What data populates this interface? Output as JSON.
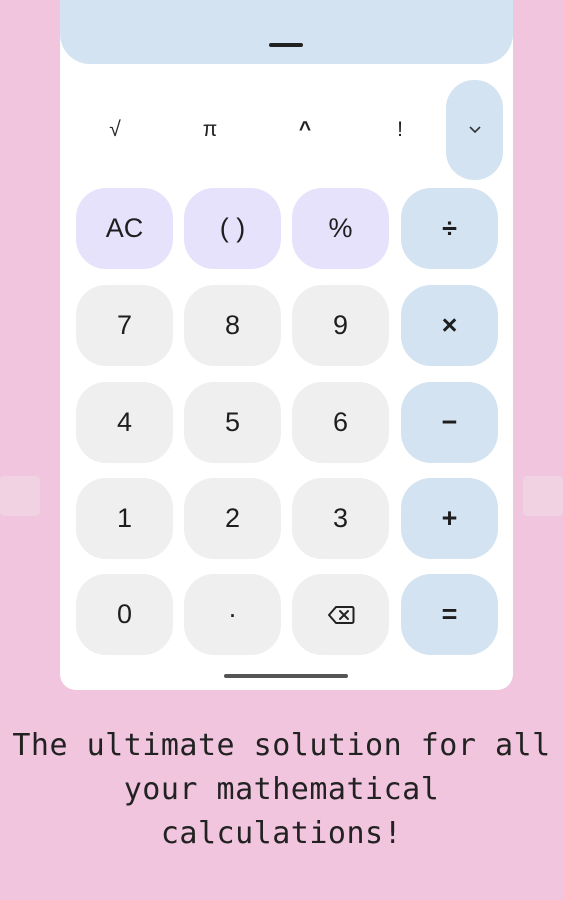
{
  "display": {
    "value": ""
  },
  "scientific": {
    "keys": [
      "√",
      "π",
      "^",
      "!"
    ],
    "expand_icon": "chevron-down-icon"
  },
  "keypad": {
    "rows": [
      [
        "AC",
        "( )",
        "%",
        "÷"
      ],
      [
        "7",
        "8",
        "9",
        "×"
      ],
      [
        "4",
        "5",
        "6",
        "−"
      ],
      [
        "1",
        "2",
        "3",
        "+"
      ],
      [
        "0",
        "·",
        "backspace-icon",
        "="
      ]
    ]
  },
  "tagline": {
    "line1": "The ultimate solution for all",
    "line2": "your mathematical",
    "line3": "calculations!"
  },
  "colors": {
    "background": "#f2c5df",
    "display": "#d3e3f2",
    "operator": "#d3e3f2",
    "function": "#e6e2fb",
    "digit": "#efefef"
  }
}
